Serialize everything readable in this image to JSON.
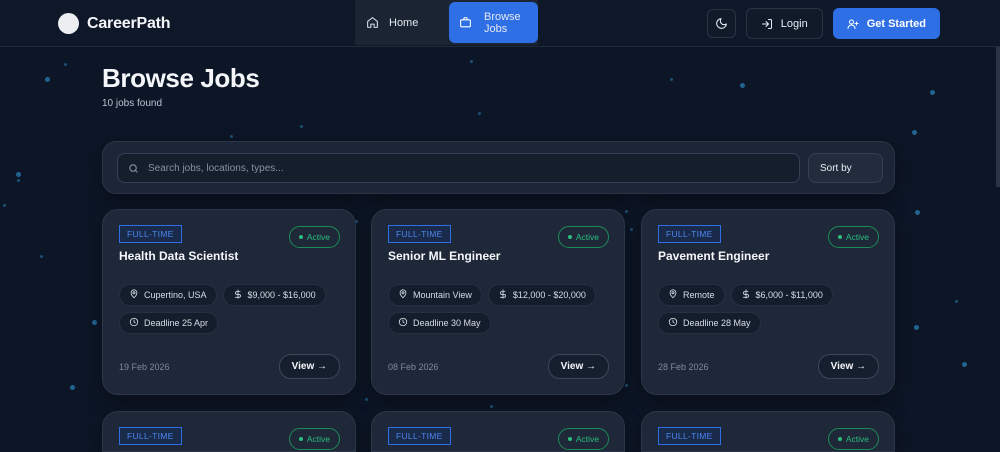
{
  "navbar": {
    "brand": "CareerPath",
    "links": [
      {
        "label": "Home",
        "icon": "home-icon",
        "active": false
      },
      {
        "label": "Browse Jobs",
        "icon": "briefcase-icon",
        "active": true
      }
    ],
    "theme_icon": "moon-icon",
    "login_label": "Login",
    "get_started_label": "Get Started",
    "accent_color": "#2f6fe6"
  },
  "header": {
    "title": "Browse Jobs",
    "count": "10 jobs found"
  },
  "search": {
    "placeholder": "Search jobs, locations, types...",
    "value": "",
    "sort_label": "Sort by"
  },
  "jobs": [
    {
      "type": "FULL-TIME",
      "status": "Active",
      "title": "Health Data Scientist",
      "location": "Cupertino, USA",
      "salary": "$9,000 - $16,000",
      "deadline": "Deadline 25 Apr",
      "posted": "19 Feb 2026",
      "view_label": "View →"
    },
    {
      "type": "FULL-TIME",
      "status": "Active",
      "title": "Senior ML Engineer",
      "location": "Mountain View",
      "salary": "$12,000 - $20,000",
      "deadline": "Deadline 30 May",
      "posted": "08 Feb 2026",
      "view_label": "View →"
    },
    {
      "type": "FULL-TIME",
      "status": "Active",
      "title": "Pavement Engineer",
      "location": "Remote",
      "salary": "$6,000 - $11,000",
      "deadline": "Deadline 28 May",
      "posted": "28 Feb 2026",
      "view_label": "View →"
    },
    {
      "type": "FULL-TIME",
      "status": "Active"
    },
    {
      "type": "FULL-TIME",
      "status": "Active"
    },
    {
      "type": "FULL-TIME",
      "status": "Active"
    }
  ],
  "colors": {
    "background": "#0d1626",
    "card": "#1e2838",
    "status_green": "#2bbd7e"
  }
}
